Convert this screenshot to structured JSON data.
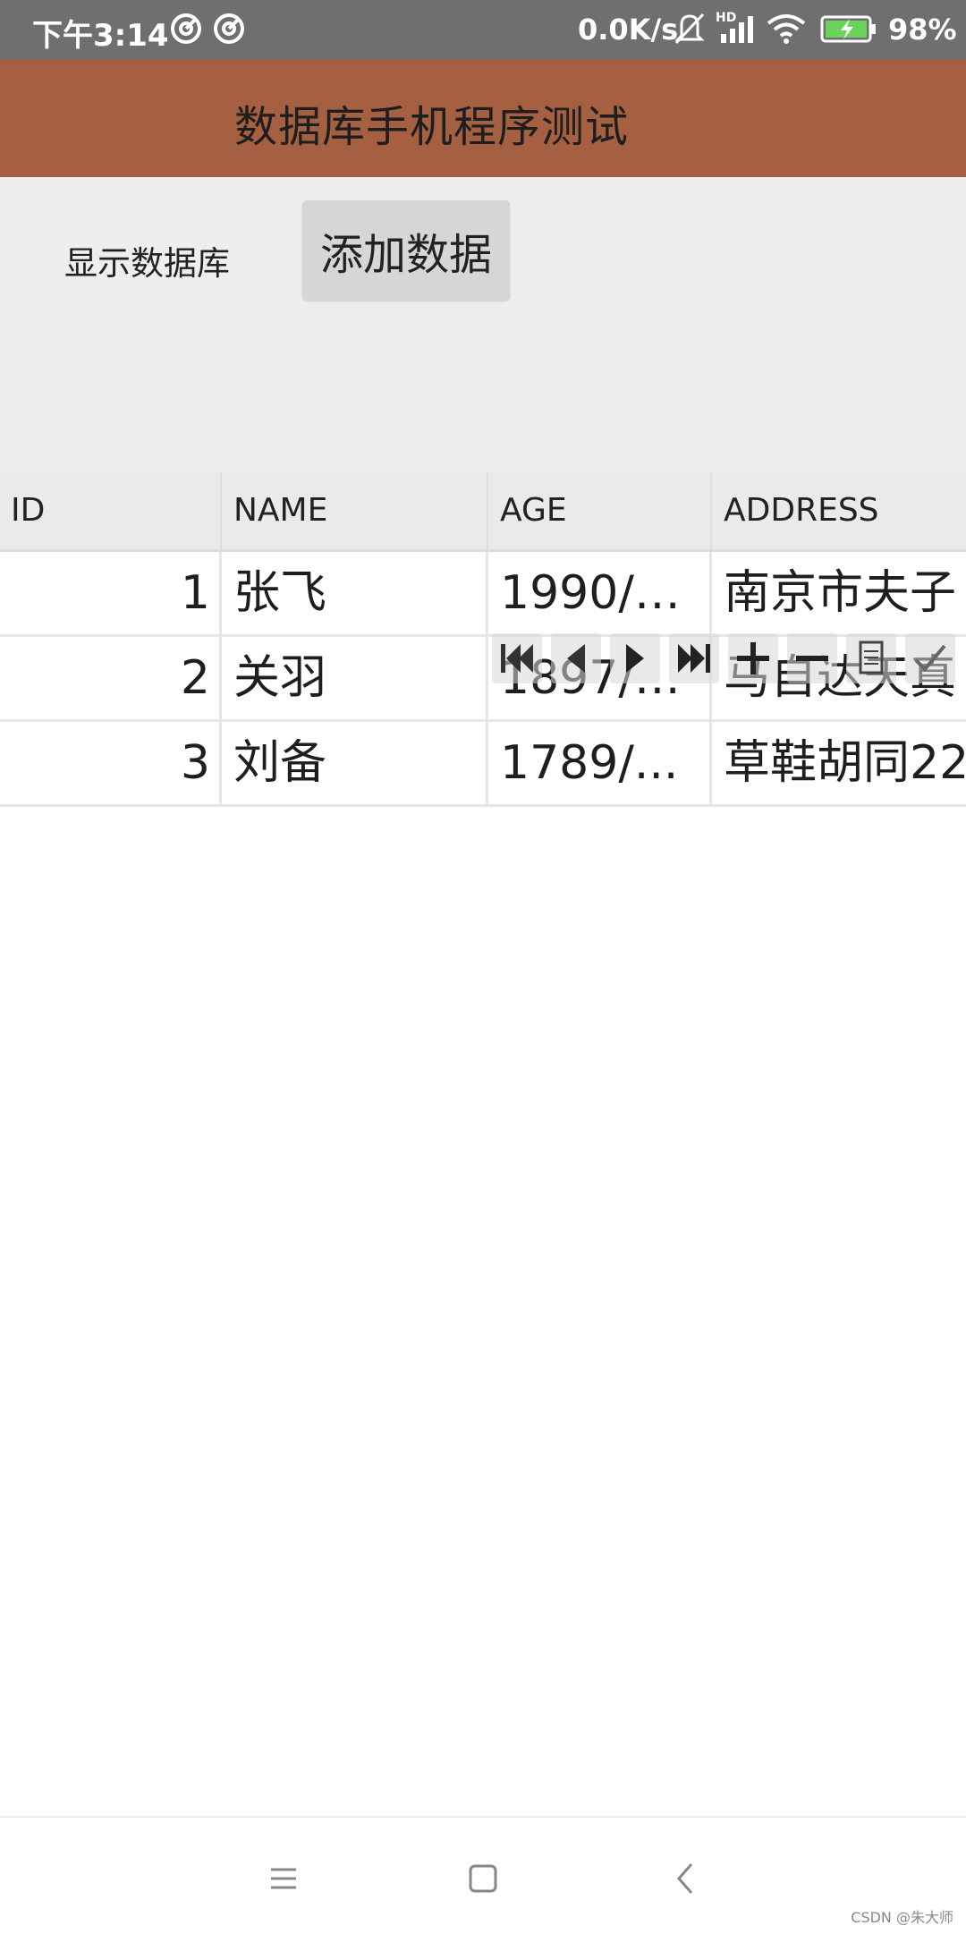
{
  "status_bar": {
    "time": "下午3:14",
    "speed": "0.0K/s",
    "network": "HD",
    "battery": "98%",
    "icons": [
      "notification-icon",
      "notification-icon",
      "mute-icon",
      "signal-icon",
      "wifi-icon",
      "battery-icon"
    ]
  },
  "app_bar": {
    "title": "数据库手机程序测试",
    "color": "#a46040"
  },
  "controls": {
    "show_db_label": "显示数据库",
    "add_button": "添加数据"
  },
  "grid": {
    "columns": [
      "ID",
      "NAME",
      "AGE",
      "ADDRESS"
    ],
    "rows": [
      {
        "id": "1",
        "name": "张飞",
        "age": "1990/1...",
        "address": "南京市夫子"
      },
      {
        "id": "2",
        "name": "关羽",
        "age": "1897/1...",
        "address": "马自达天真"
      },
      {
        "id": "3",
        "name": "刘备",
        "age": "1789/...",
        "address": "草鞋胡同22"
      }
    ]
  },
  "navigator": {
    "buttons": [
      "first-icon",
      "prior-icon",
      "next-icon",
      "last-icon",
      "insert-icon",
      "delete-icon",
      "edit-icon",
      "post-icon"
    ]
  },
  "bottom_nav": {
    "buttons": [
      "menu-icon",
      "home-icon",
      "back-icon"
    ]
  },
  "watermark": "CSDN @朱大师"
}
